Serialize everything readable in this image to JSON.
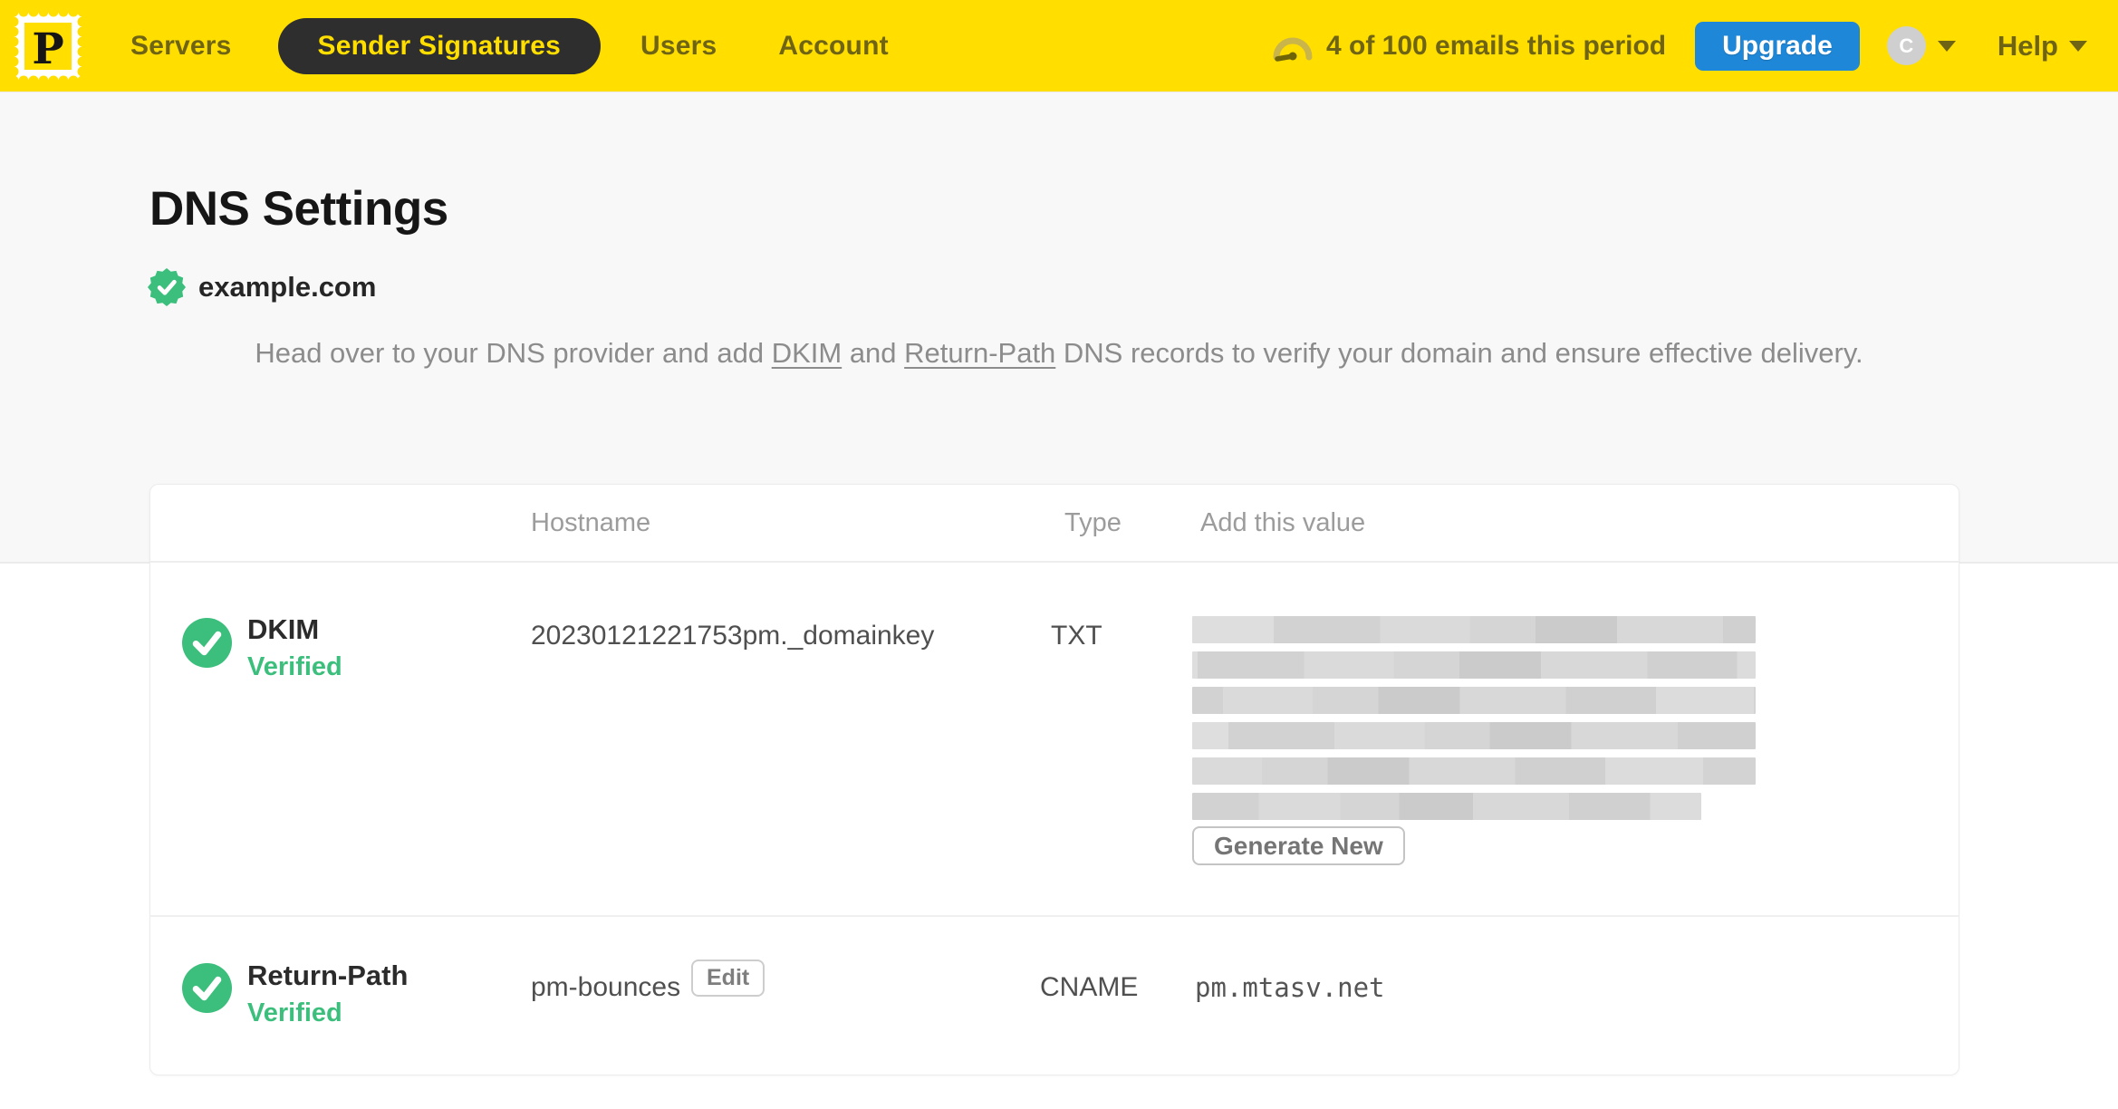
{
  "topbar": {
    "logo_letter": "P",
    "nav": [
      {
        "label": "Servers",
        "active": false
      },
      {
        "label": "Sender Signatures",
        "active": true
      },
      {
        "label": "Users",
        "active": false
      },
      {
        "label": "Account",
        "active": false
      }
    ],
    "usage": "4 of 100 emails this period",
    "upgrade_label": "Upgrade",
    "avatar_initial": "C",
    "help_label": "Help"
  },
  "page": {
    "title": "DNS Settings",
    "domain": "example.com",
    "domain_verified": true,
    "desc": {
      "part1": "Head over to your DNS provider and add ",
      "link1": "DKIM",
      "part2": " and ",
      "link2": "Return-Path",
      "part3": " DNS records to verify your domain and ensure effective delivery."
    }
  },
  "table": {
    "headers": [
      "Hostname",
      "Type",
      "Add this value"
    ],
    "rows": [
      {
        "name": "DKIM",
        "status": "Verified",
        "hostname": "20230121221753pm._domainkey",
        "type": "TXT",
        "value_redacted": true,
        "action": "Generate New"
      },
      {
        "name": "Return-Path",
        "status": "Verified",
        "hostname": "pm-bounces",
        "edit_label": "Edit",
        "type": "CNAME",
        "value": "pm.mtasv.net"
      }
    ]
  },
  "colors": {
    "brand_yellow": "#FFDE00",
    "nav_text_olive": "#6F6414",
    "active_pill_bg": "#2E2E2E",
    "upgrade_blue": "#1F87D7",
    "success_green": "#3CBE7C",
    "page_bg": "#F8F8F8"
  }
}
